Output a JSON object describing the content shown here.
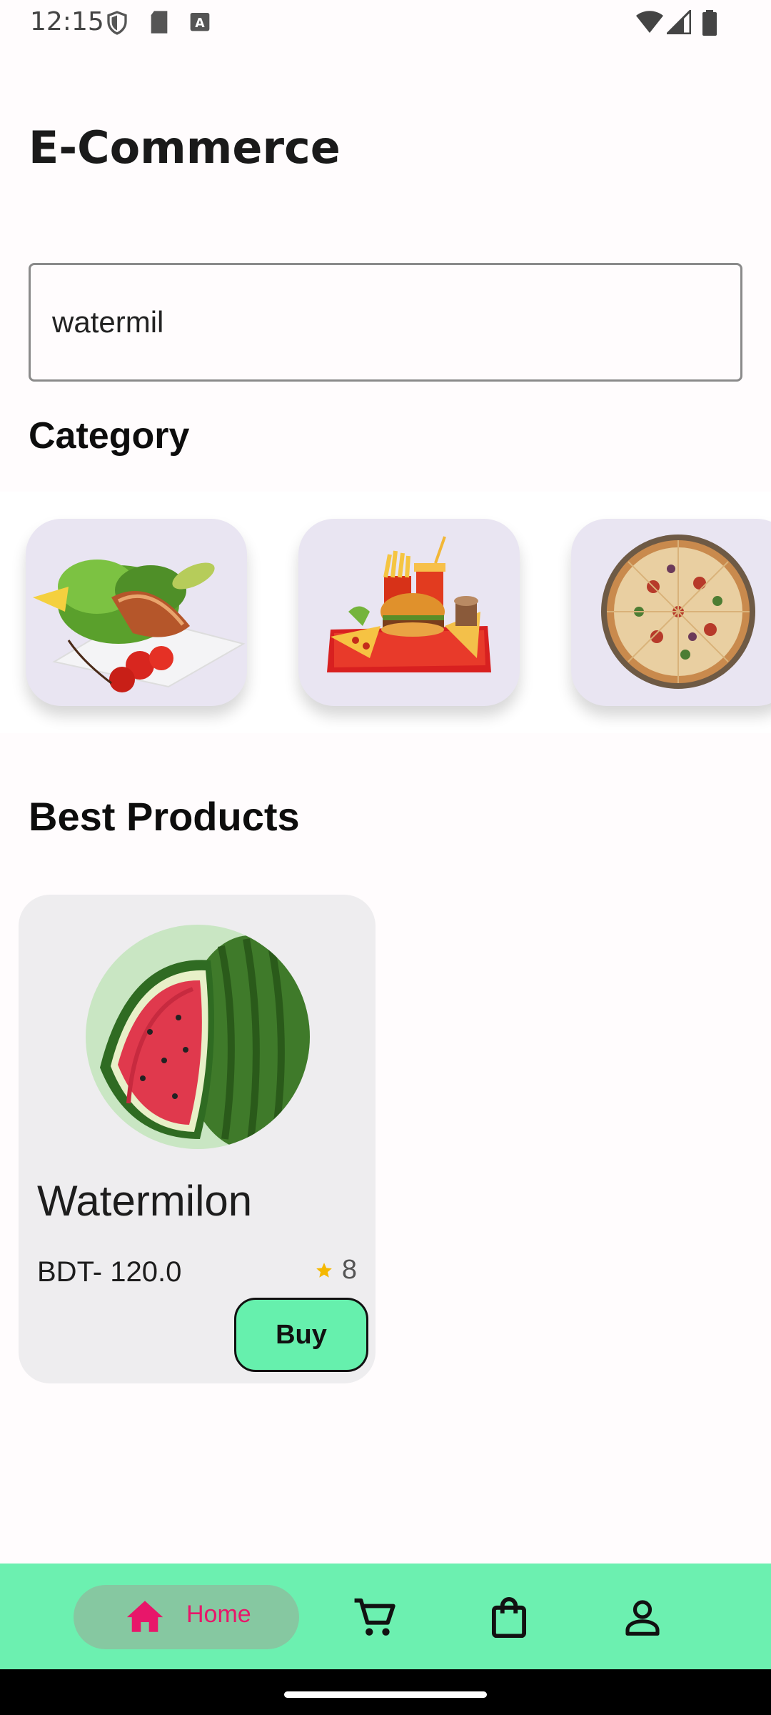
{
  "status_bar": {
    "time": "12:15"
  },
  "header": {
    "title": "E-Commerce"
  },
  "search": {
    "value": "watermil"
  },
  "category": {
    "title": "Category",
    "items": [
      {
        "icon": "salmon-salad-image"
      },
      {
        "icon": "fast-food-image"
      },
      {
        "icon": "pizza-image"
      }
    ]
  },
  "best_products": {
    "title": "Best Products",
    "items": [
      {
        "name": "Watermilon",
        "price": "BDT- 120.0",
        "rating": "8",
        "buy_label": "Buy"
      }
    ]
  },
  "bottom_nav": {
    "home_label": "Home",
    "items": [
      "home-icon",
      "cart-icon",
      "shopping-bag-icon",
      "profile-icon"
    ],
    "active_color": "#e8166a",
    "bar_color": "#6cf0b0"
  }
}
